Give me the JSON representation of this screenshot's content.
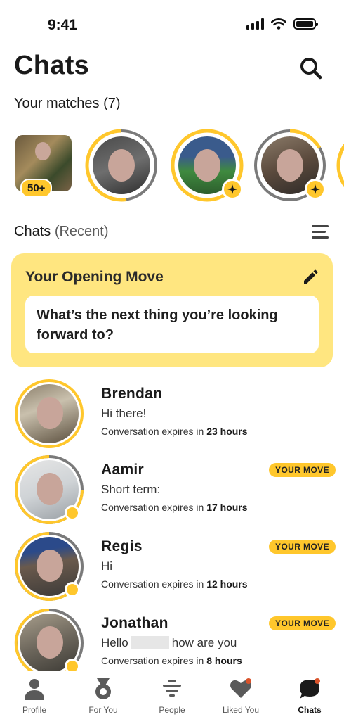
{
  "status_bar": {
    "time": "9:41"
  },
  "header": {
    "title": "Chats"
  },
  "matches": {
    "label": "Your matches",
    "count": "(7)",
    "likes_badge": "50+"
  },
  "chats_section": {
    "label": "Chats",
    "sublabel": "(Recent)"
  },
  "opening_move": {
    "title": "Your Opening Move",
    "question": "What’s the next thing you’re looking forward to?"
  },
  "conversations": [
    {
      "name": "Brendan",
      "message": "Hi there!",
      "expiry_prefix": "Conversation expires in",
      "expiry_value": "23 hours",
      "badge": ""
    },
    {
      "name": "Aamir",
      "message": "Short term:",
      "expiry_prefix": "Conversation expires in",
      "expiry_value": "17 hours",
      "badge": "YOUR MOVE"
    },
    {
      "name": "Regis",
      "message": "Hi",
      "expiry_prefix": "Conversation expires in",
      "expiry_value": "12 hours",
      "badge": "YOUR MOVE"
    },
    {
      "name": "Jonathan",
      "message_before": "Hello",
      "message_after": "how are you",
      "expiry_prefix": "Conversation expires in",
      "expiry_value": "8 hours",
      "badge": "YOUR MOVE"
    }
  ],
  "tabs": [
    {
      "label": "Profile",
      "icon": "profile-icon"
    },
    {
      "label": "For You",
      "icon": "medal-icon"
    },
    {
      "label": "People",
      "icon": "people-stack-icon"
    },
    {
      "label": "Liked You",
      "icon": "heart-icon"
    },
    {
      "label": "Chats",
      "icon": "chat-bubble-icon"
    }
  ],
  "colors": {
    "accent": "#ffc72c",
    "card": "#ffe680",
    "notification": "#d9532b"
  }
}
